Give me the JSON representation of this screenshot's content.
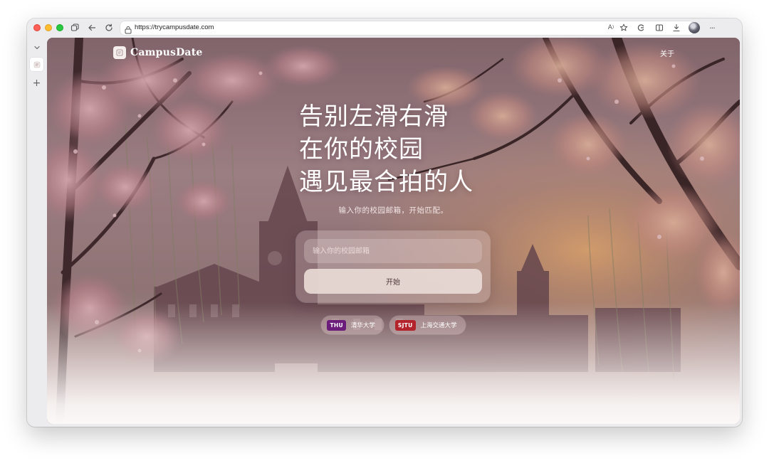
{
  "browser": {
    "url": "https://trycampusdate.com"
  },
  "header": {
    "brand": "CampusDate",
    "about": "关于"
  },
  "hero": {
    "headline": [
      "告别左滑右滑",
      "在你的校园",
      "遇见最合拍的人"
    ],
    "subtitle": "输入你的校园邮箱，开始匹配。"
  },
  "form": {
    "email_placeholder": "输入你的校园邮箱",
    "start_label": "开始"
  },
  "schools": [
    {
      "code": "THU",
      "name": "清华大学",
      "color": "#6c1d7c"
    },
    {
      "code": "SJTU",
      "name": "上海交通大学",
      "color": "#b3232b"
    }
  ]
}
